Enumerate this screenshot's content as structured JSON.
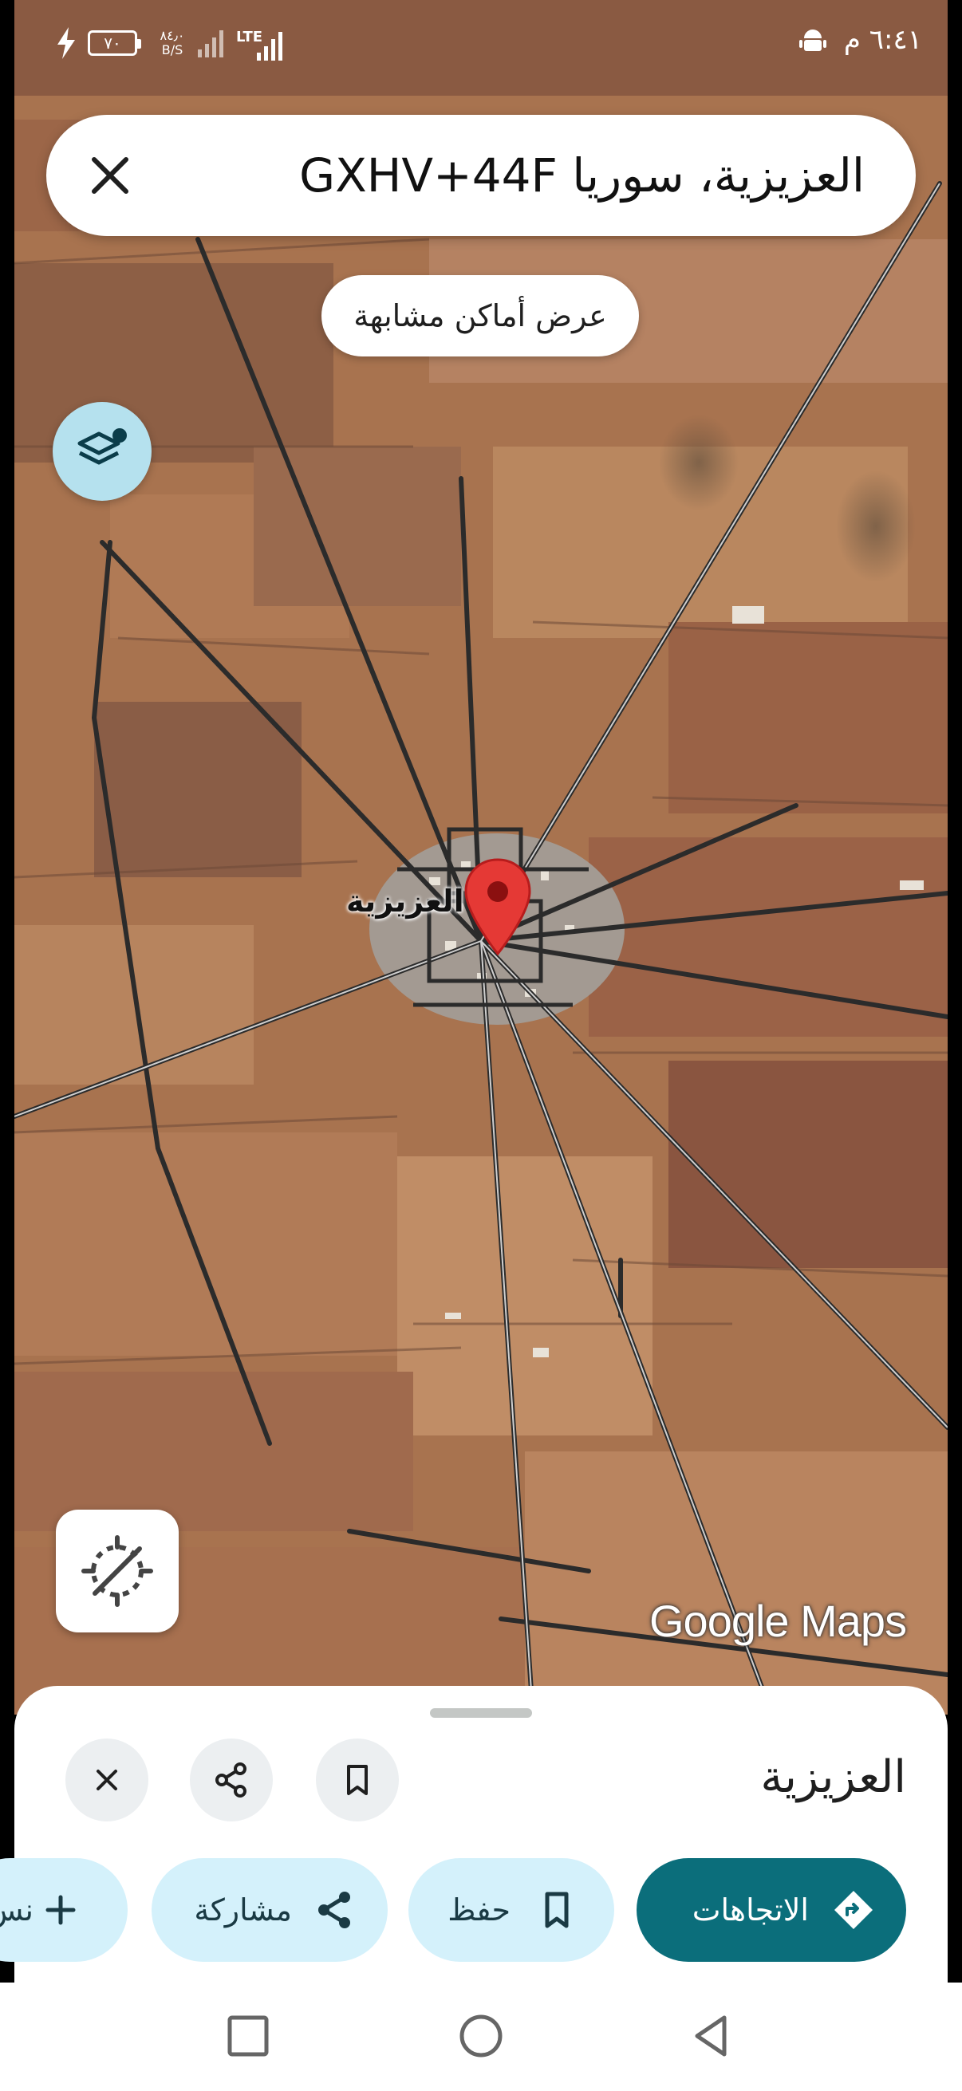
{
  "status_bar": {
    "time": "٦:٤١ م",
    "battery_level": "٧٠",
    "net_speed_value": "٨٤٫٠",
    "net_speed_unit": "B/S",
    "network_type": "LTE"
  },
  "search": {
    "query": "العزيزية، سوريا GXHV+44F"
  },
  "map": {
    "similar_places_label": "عرض أماكن مشابهة",
    "place_label": "العزيزية",
    "attribution": "Google Maps"
  },
  "sheet": {
    "title": "العزيزية",
    "actions": {
      "directions": "الاتجاهات",
      "save": "حفظ",
      "share": "مشاركة",
      "more": "نس"
    }
  },
  "colors": {
    "directions_bg": "#0b6e7b",
    "chip_bg": "#d4f1fb",
    "layers_bg": "#b5e1ee",
    "pin_red": "#e53935"
  },
  "icons": [
    "android-icon",
    "charging-icon",
    "signal-icon",
    "close-icon",
    "layers-icon",
    "location-off-icon",
    "map-pin-icon",
    "share-icon",
    "bookmark-icon",
    "directions-icon",
    "plus-icon",
    "square-icon",
    "circle-icon",
    "triangle-icon"
  ]
}
